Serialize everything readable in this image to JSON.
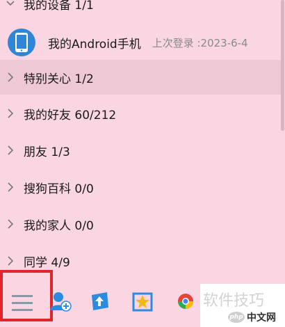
{
  "device_group": {
    "label": "我的设备 1/1"
  },
  "device": {
    "name": "我的Android手机",
    "last_login": "上次登录 :2023-6-4"
  },
  "groups": [
    {
      "label": "特别关心 1/2",
      "selected": true
    },
    {
      "label": "我的好友 60/212",
      "selected": false
    },
    {
      "label": "朋友 1/3",
      "selected": false
    },
    {
      "label": "搜狗百科 0/0",
      "selected": false
    },
    {
      "label": "我的家人 0/0",
      "selected": false
    },
    {
      "label": "同学 4/9",
      "selected": false
    }
  ],
  "toolbar": {
    "icons": [
      "menu-icon",
      "add-contact-icon",
      "share-icon",
      "star-app-icon",
      "chrome-app-icon"
    ]
  },
  "watermark": {
    "text": "软件技巧",
    "logo_badge": "php",
    "logo_text": "中文网"
  },
  "colors": {
    "background": "#f9d6e2",
    "selected_row": "#efc8d5",
    "highlight_border": "#e0262b",
    "avatar": "#2f86d6",
    "accent_blue": "#2a8be0"
  }
}
